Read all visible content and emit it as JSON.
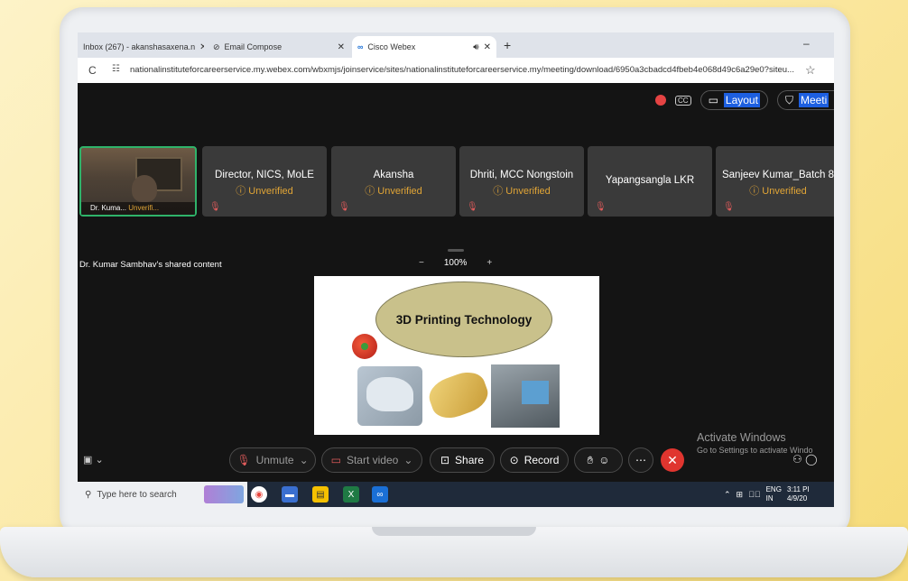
{
  "browser": {
    "tabs": [
      {
        "title": "Inbox (267) - akanshasaxena.n",
        "icon": "mail-icon"
      },
      {
        "title": "Email Compose",
        "icon": "compose-icon"
      },
      {
        "title": "Cisco Webex",
        "icon": "webex-icon",
        "active": true
      }
    ],
    "url": "nationalinstituteforcareerservice.my.webex.com/wbxmjs/joinservice/sites/nationalinstituteforcareerservice.my/meeting/download/6950a3cbadcd4fbeb4e068d49c6a29e0?siteu..."
  },
  "meeting": {
    "top_buttons": {
      "layout": "Layout",
      "meeting_info": "Meeti"
    },
    "participants": [
      {
        "name": "Dr. Kuma...",
        "status": "Unverifi...",
        "video": true
      },
      {
        "name": "Director, NICS, MoLE",
        "status": "Unverified"
      },
      {
        "name": "Akansha",
        "status": "Unverified"
      },
      {
        "name": "Dhriti, MCC Nongstoin",
        "status": "Unverified"
      },
      {
        "name": "Yapangsangla LKR",
        "status": ""
      },
      {
        "name": "Sanjeev Kumar_Batch 8",
        "status": "Unverified"
      }
    ],
    "shared_content_title": "Dr. Kumar Sambhav's shared content",
    "zoom": {
      "minus": "−",
      "value": "100%",
      "plus": "+"
    },
    "slide": {
      "title": "3D Printing Technology"
    },
    "controls": {
      "unmute": "Unmute",
      "start_video": "Start video",
      "share": "Share",
      "record": "Record"
    }
  },
  "overlay": {
    "activate_title": "Activate Windows",
    "activate_sub": "Go to Settings to activate Windo"
  },
  "taskbar": {
    "search_placeholder": "Type here to search",
    "lang": "ENG",
    "region": "IN",
    "time": "3:11 PI",
    "date": "4/9/20"
  },
  "colors": {
    "unverified": "#e1a536",
    "active_border": "#2fb36a",
    "end_call": "#e0352f",
    "highlight": "#1d5fe0"
  }
}
